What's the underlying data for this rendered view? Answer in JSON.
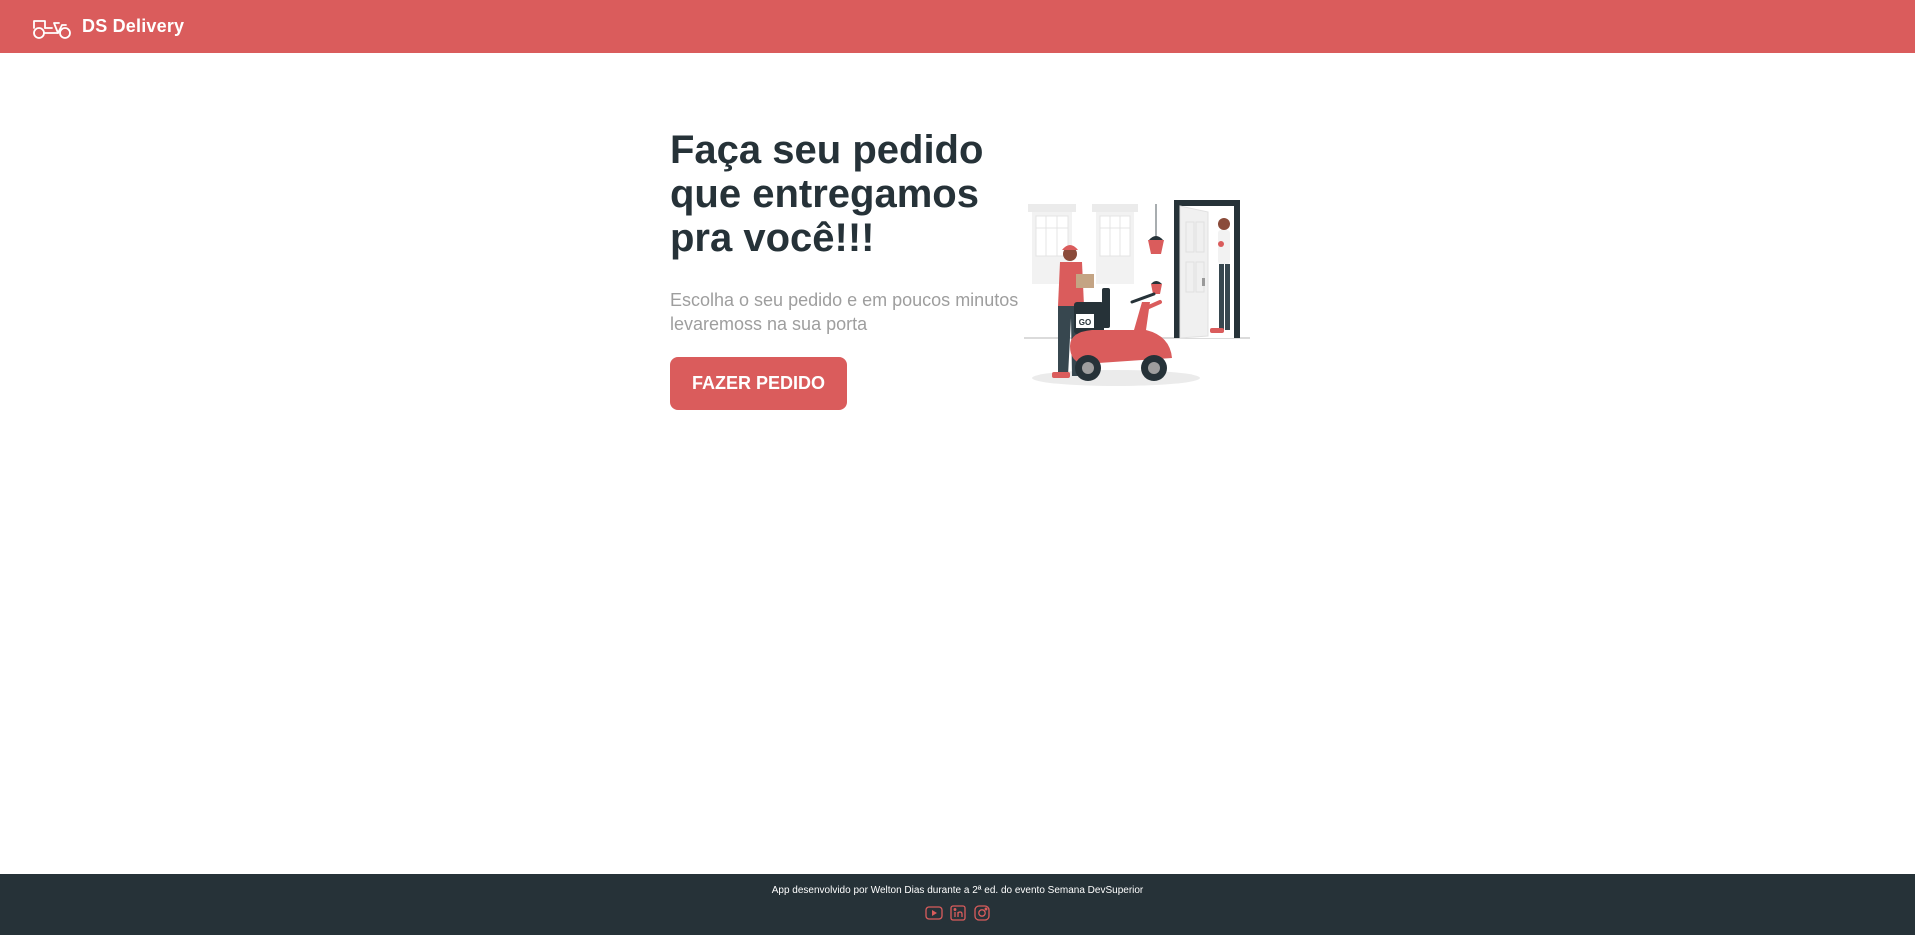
{
  "navbar": {
    "logo_icon": "scooter-icon",
    "title": "DS Delivery",
    "color": "#da5c5c"
  },
  "home": {
    "title": "Faça seu pedido que entregamos pra você!!!",
    "subtitle": "Escolha o seu pedido e em poucos minutos levaremoss na sua porta",
    "button_label": "FAZER PEDIDO",
    "illustration": {
      "name": "delivery-illustration",
      "box_text": "GO"
    }
  },
  "footer": {
    "text": "App desenvolvido por Welton Dias durante a 2ª ed. do evento Semana DevSuperior",
    "icons": [
      "youtube-icon",
      "linkedin-icon",
      "instagram-icon"
    ],
    "color": "#263238"
  }
}
